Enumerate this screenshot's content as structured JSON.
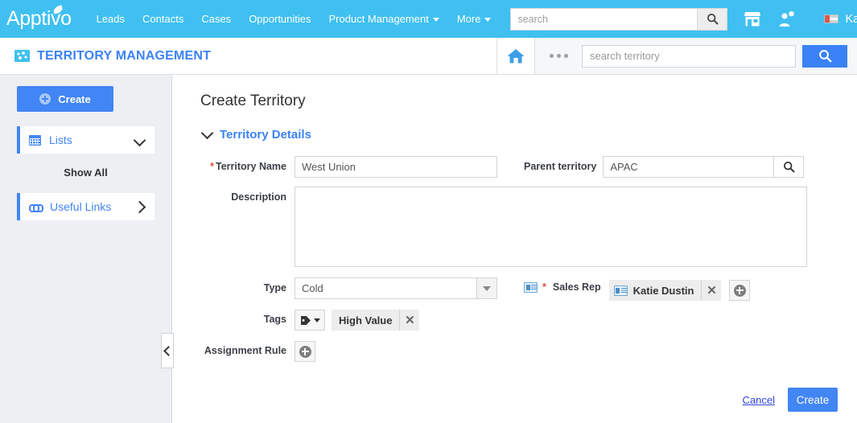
{
  "topnav": {
    "logo": "Apptivo",
    "items": [
      {
        "label": "Leads",
        "caret": false
      },
      {
        "label": "Contacts",
        "caret": false
      },
      {
        "label": "Cases",
        "caret": false
      },
      {
        "label": "Opportunities",
        "caret": false
      },
      {
        "label": "Product Management",
        "caret": true
      },
      {
        "label": "More",
        "caret": true
      }
    ],
    "search_placeholder": "search",
    "search_value": "",
    "icons": [
      "search-icon",
      "store-icon",
      "user-notification-icon"
    ],
    "user_name": "Katie Dustin"
  },
  "subheader": {
    "app_title": "TERRITORY MANAGEMENT",
    "app_icon": "globe-icon",
    "home_icon": "home-icon",
    "more_icon": "three-dots-icon",
    "search_placeholder": "search territory",
    "search_value": "",
    "search_button_icon": "search-icon"
  },
  "sidebar": {
    "create_label": "Create",
    "items": [
      {
        "label": "Lists",
        "icon": "grid-icon",
        "chevron": "down"
      },
      {
        "label": "Useful Links",
        "icon": "link-icon",
        "chevron": "right"
      }
    ],
    "show_all_label": "Show All",
    "collapse_icon": "chevron-left-icon"
  },
  "main": {
    "page_title": "Create Territory",
    "section_title": "Territory Details",
    "fields": {
      "territory_name": {
        "label": "Territory Name",
        "required": true,
        "value": "West Union"
      },
      "parent_territory": {
        "label": "Parent territory",
        "required": false,
        "value": "APAC"
      },
      "description": {
        "label": "Description",
        "value": ""
      },
      "type": {
        "label": "Type",
        "value": "Cold"
      },
      "sales_rep": {
        "label": "Sales Rep",
        "required": true,
        "chip": "Katie Dustin"
      },
      "tags": {
        "label": "Tags",
        "chip": "High Value"
      },
      "assignment_rule": {
        "label": "Assignment Rule"
      }
    }
  },
  "footer": {
    "cancel_label": "Cancel",
    "create_label": "Create"
  },
  "colors": {
    "brand_cyan": "#3FC0F0",
    "accent_blue": "#4285f4",
    "link_blue": "#3b82f6",
    "required_red": "#e04e3c",
    "sidebar_bg": "#edeff2"
  }
}
